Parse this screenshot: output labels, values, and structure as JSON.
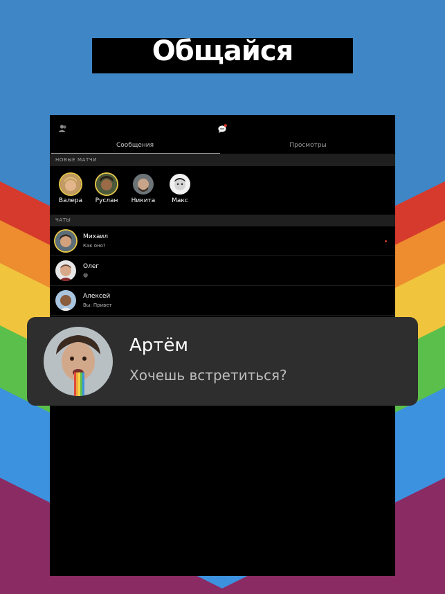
{
  "headline": "Общайся",
  "tabs": {
    "messages": "Сообщения",
    "views": "Просмотры"
  },
  "sections": {
    "new_matches": "НОВЫЕ МАТЧИ",
    "chats": "ЧАТЫ"
  },
  "matches": [
    {
      "name": "Валера",
      "ring": true
    },
    {
      "name": "Руслан",
      "ring": true
    },
    {
      "name": "Никита",
      "ring": false
    },
    {
      "name": "Макс",
      "ring": false
    }
  ],
  "chats": [
    {
      "name": "Михаил",
      "message": "Как оно?",
      "unread": true
    },
    {
      "name": "Олег",
      "message": "😁",
      "unread": false
    },
    {
      "name": "Алексей",
      "message": "Вы: Привет",
      "unread": false
    }
  ],
  "notification": {
    "title": "Артём",
    "body": "Хочешь встретиться?"
  },
  "colors": {
    "background": "#3e86c6",
    "accent_ring": "#e5c64a",
    "unread_dot": "#d23b2a",
    "chat_icon_badge": "#e23c2b"
  },
  "icons": {
    "users_tab": "users-icon",
    "chat_tab": "chat-bubble-icon"
  }
}
